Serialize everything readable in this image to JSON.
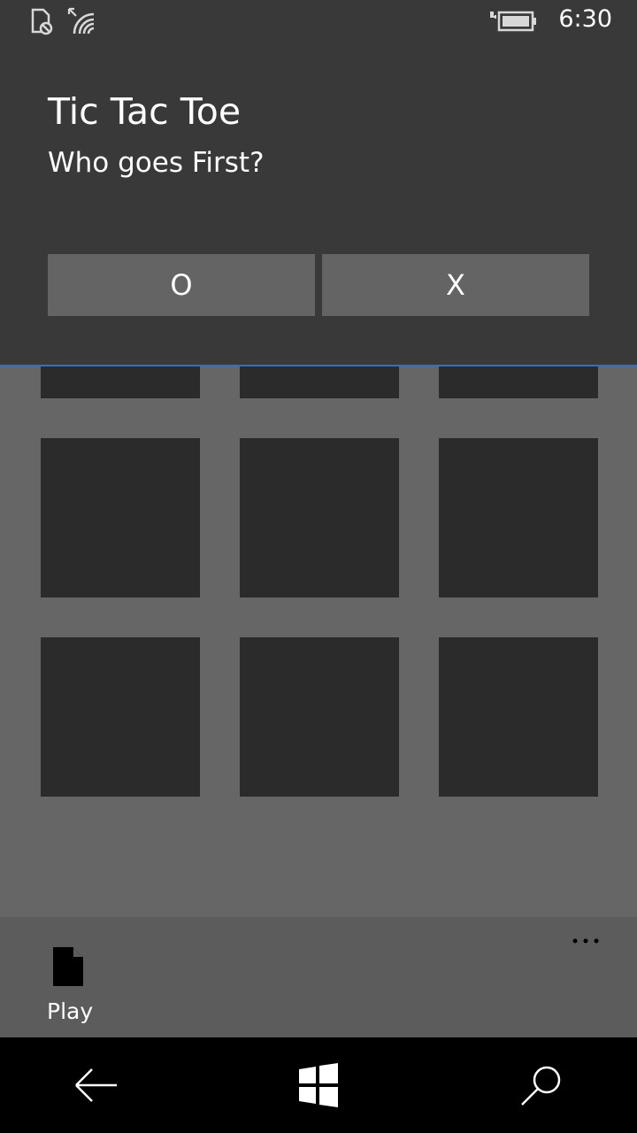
{
  "status_bar": {
    "time": "6:30",
    "icons": [
      "no-sim-icon",
      "wifi-icon",
      "battery-charging-icon"
    ]
  },
  "dialog": {
    "title": "Tic Tac Toe",
    "subtitle": "Who goes First?",
    "option_o": "O",
    "option_x": "X",
    "accent_color": "#3e65e0"
  },
  "board": {
    "cells": [
      "",
      "",
      "",
      "",
      "",
      "",
      "",
      "",
      ""
    ]
  },
  "app_bar": {
    "play_label": "Play",
    "play_icon": "document-icon",
    "more_icon": "more-icon"
  },
  "nav_bar": {
    "icons": [
      "back-arrow-icon",
      "windows-icon",
      "search-icon"
    ]
  }
}
